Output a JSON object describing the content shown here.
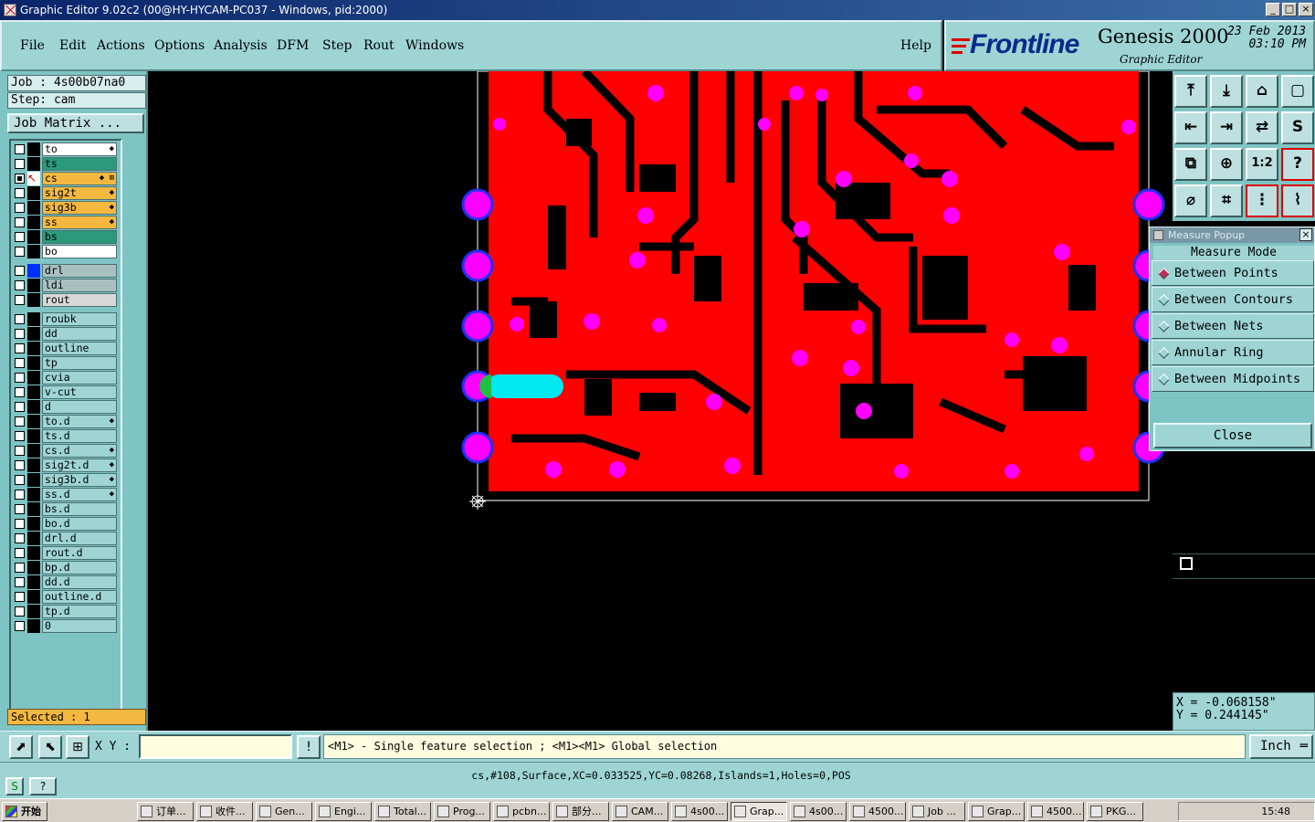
{
  "window": {
    "title": "Graphic Editor 9.02c2 (00@HY-HYCAM-PC037 - Windows, pid:2000)",
    "controls": [
      "_",
      "□",
      "×"
    ]
  },
  "menu": [
    "File",
    "Edit",
    "Actions",
    "Options",
    "Analysis",
    "DFM",
    "Step",
    "Rout",
    "Windows"
  ],
  "help_label": "Help",
  "brand": {
    "logo": "Frontline",
    "product": "Genesis 2000",
    "subtitle": "Graphic Editor",
    "date": "23 Feb 2013",
    "time": "03:10 PM"
  },
  "job": {
    "job_label": "Job : 4s00b07na0",
    "step_label": "Step: cam",
    "matrix_button": "Job Matrix ..."
  },
  "layers": [
    {
      "name": "to",
      "color": "#ffffff",
      "checked": false,
      "mark": "◆"
    },
    {
      "name": "ts",
      "color": "#2a9a7a",
      "checked": false,
      "mark": ""
    },
    {
      "name": "cs",
      "color": "#f4b840",
      "checked": true,
      "mark": "◆ ⊞"
    },
    {
      "name": "sig2t",
      "color": "#f4b840",
      "checked": false,
      "mark": "◆"
    },
    {
      "name": "sig3b",
      "color": "#f4b840",
      "checked": false,
      "mark": "◆"
    },
    {
      "name": "ss",
      "color": "#f4b840",
      "checked": false,
      "mark": "◆"
    },
    {
      "name": "bs",
      "color": "#2a9a7a",
      "checked": false,
      "mark": ""
    },
    {
      "name": "bo",
      "color": "#ffffff",
      "checked": false,
      "mark": ""
    },
    {
      "name": "drl",
      "color": "#a8c0c0",
      "checked": false,
      "mark": ""
    },
    {
      "name": "ldi",
      "color": "#a8c0c0",
      "checked": false,
      "mark": ""
    },
    {
      "name": "rout",
      "color": "#d8d8d8",
      "checked": false,
      "mark": ""
    },
    {
      "name": "roubk",
      "color": "#9ed4d4",
      "checked": false,
      "mark": ""
    },
    {
      "name": "dd",
      "color": "#9ed4d4",
      "checked": false,
      "mark": ""
    },
    {
      "name": "outline",
      "color": "#9ed4d4",
      "checked": false,
      "mark": ""
    },
    {
      "name": "tp",
      "color": "#9ed4d4",
      "checked": false,
      "mark": ""
    },
    {
      "name": "cvia",
      "color": "#9ed4d4",
      "checked": false,
      "mark": ""
    },
    {
      "name": "v-cut",
      "color": "#9ed4d4",
      "checked": false,
      "mark": ""
    },
    {
      "name": "d",
      "color": "#9ed4d4",
      "checked": false,
      "mark": ""
    },
    {
      "name": "to.d",
      "color": "#9ed4d4",
      "checked": false,
      "mark": "◆"
    },
    {
      "name": "ts.d",
      "color": "#9ed4d4",
      "checked": false,
      "mark": ""
    },
    {
      "name": "cs.d",
      "color": "#9ed4d4",
      "checked": false,
      "mark": "◆"
    },
    {
      "name": "sig2t.d",
      "color": "#9ed4d4",
      "checked": false,
      "mark": "◆"
    },
    {
      "name": "sig3b.d",
      "color": "#9ed4d4",
      "checked": false,
      "mark": "◆"
    },
    {
      "name": "ss.d",
      "color": "#9ed4d4",
      "checked": false,
      "mark": "◆"
    },
    {
      "name": "bs.d",
      "color": "#9ed4d4",
      "checked": false,
      "mark": ""
    },
    {
      "name": "bo.d",
      "color": "#9ed4d4",
      "checked": false,
      "mark": ""
    },
    {
      "name": "drl.d",
      "color": "#9ed4d4",
      "checked": false,
      "mark": ""
    },
    {
      "name": "rout.d",
      "color": "#9ed4d4",
      "checked": false,
      "mark": ""
    },
    {
      "name": "bp.d",
      "color": "#9ed4d4",
      "checked": false,
      "mark": ""
    },
    {
      "name": "dd.d",
      "color": "#9ed4d4",
      "checked": false,
      "mark": ""
    },
    {
      "name": "outline.d",
      "color": "#9ed4d4",
      "checked": false,
      "mark": ""
    },
    {
      "name": "tp.d",
      "color": "#9ed4d4",
      "checked": false,
      "mark": ""
    },
    {
      "name": "0",
      "color": "#9ed4d4",
      "checked": false,
      "mark": ""
    }
  ],
  "selected_label": "Selected : 1",
  "toolbar_icons": [
    {
      "name": "step-up-icon",
      "glyph": "⤒"
    },
    {
      "name": "step-down-icon",
      "glyph": "⤓"
    },
    {
      "name": "home-icon",
      "glyph": "⌂"
    },
    {
      "name": "window-icon",
      "glyph": "▢"
    },
    {
      "name": "zoom-left-icon",
      "glyph": "⇤"
    },
    {
      "name": "zoom-right-icon",
      "glyph": "⇥"
    },
    {
      "name": "flip-icon",
      "glyph": "⇄"
    },
    {
      "name": "swap-icon",
      "glyph": "S"
    },
    {
      "name": "fit-icon",
      "glyph": "⧉"
    },
    {
      "name": "center-icon",
      "glyph": "⊕"
    },
    {
      "name": "scale-icon",
      "glyph": "1:2"
    },
    {
      "name": "query-icon",
      "glyph": "?"
    },
    {
      "name": "measure-icon",
      "glyph": "⌀"
    },
    {
      "name": "grid-icon",
      "glyph": "⌗"
    },
    {
      "name": "net-icon",
      "glyph": "⋮"
    },
    {
      "name": "route-icon",
      "glyph": "⌇"
    }
  ],
  "measure": {
    "title": "Measure Popup",
    "header": "Measure Mode",
    "options": [
      "Between Points",
      "Between Contours",
      "Between Nets",
      "Annular Ring",
      "Between Midpoints"
    ],
    "selected_index": 0,
    "close_label": "Close"
  },
  "coords": {
    "x": "X = -0.068158\"",
    "y": "Y = 0.244145\""
  },
  "input": {
    "xy_label": "X Y :",
    "message": "<M1> - Single feature selection ; <M1><M1> Global selection",
    "unit": "Inch"
  },
  "status": "cs,#108,Surface,XC=0.033525,YC=0.08268,Islands=1,Holes=0,POS",
  "taskbar": {
    "start": "开始",
    "tasks": [
      "订单...",
      "收件...",
      "Gen...",
      "Engi...",
      "Total...",
      "Prog...",
      "pcbn...",
      "部分...",
      "CAM...",
      "4s00...",
      "Grap...",
      "4s00...",
      "4500...",
      "Job ...",
      "Grap...",
      "4500...",
      "PKG..."
    ],
    "active_index": 10,
    "clock": "15:48"
  },
  "colors": {
    "copper": "#ff0000",
    "pad": "#ff00ff",
    "highlight": "#00e8f0",
    "panel": "#9ed4d4"
  }
}
